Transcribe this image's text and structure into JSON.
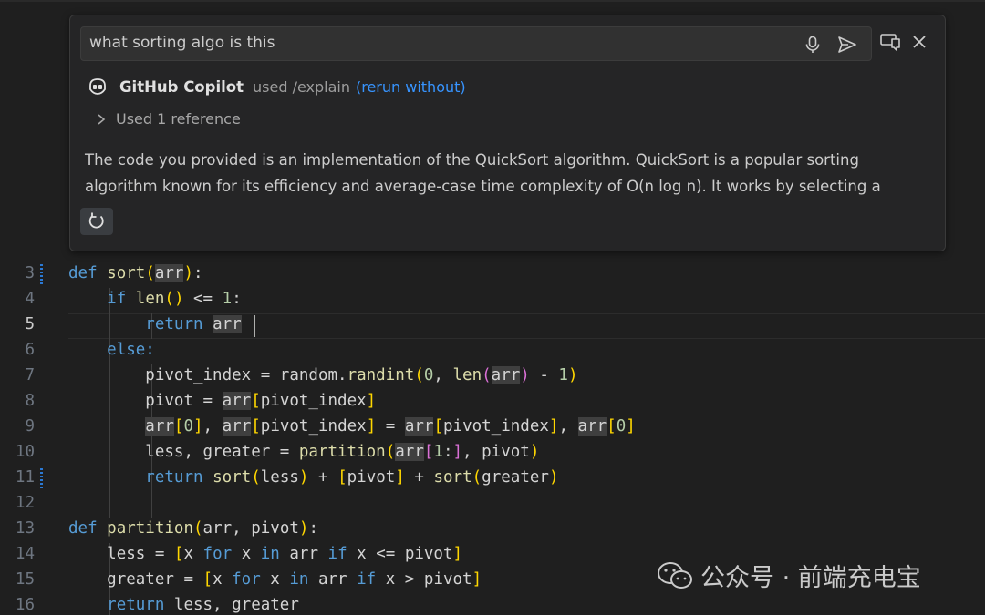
{
  "chat": {
    "query": "what sorting algo is this",
    "agent_name": "GitHub Copilot",
    "used_command": "used /explain",
    "rerun_link": "(rerun without)",
    "references": "Used 1 reference",
    "response_line1": "The code you provided is an implementation of the QuickSort algorithm. QuickSort is a popular sorting",
    "response_line2": "algorithm known for its efficiency and average-case time complexity of O(n log n). It works by selecting a"
  },
  "editor": {
    "line_numbers": [
      "3",
      "4",
      "5",
      "6",
      "7",
      "8",
      "9",
      "10",
      "11",
      "12",
      "13",
      "14",
      "15",
      "16"
    ],
    "active_line": "5"
  },
  "code": {
    "l3": {
      "def": "def",
      "sort": "sort",
      "p1": "(",
      "arr": "arr",
      "p2": ")",
      ":": ":"
    },
    "l4": {
      "if": "if",
      "len": "len",
      "rest": " <= ",
      "one": "1",
      ":": ":"
    },
    "l5": {
      "return": "return",
      "arr": "arr"
    },
    "l6": {
      "else": "else:"
    },
    "l7": {
      "pivot_index": "pivot_index = random.",
      "randint": "randint",
      "zero": "0",
      "len": "len",
      "minus": " - ",
      "one": "1"
    },
    "l8": {
      "pivot": "pivot = ",
      "arr": "arr",
      "idx": "pivot_index"
    },
    "l9": {
      "arr": "arr",
      "zero": "0",
      "idx": "pivot_index",
      "zero2": "0"
    },
    "l10": {
      "lg": "less, greater = ",
      "partition": "partition",
      "arr": "arr",
      "one": "1",
      "rest": "pivot"
    },
    "l11": {
      "return": "return",
      "sort": "sort",
      "less": "less",
      "plus": " + ",
      "pivot": "pivot",
      "greater": "greater"
    },
    "l13": {
      "def": "def",
      "partition": "partition",
      "args": "arr, pivot"
    },
    "l14": {
      "a": "less = ",
      "x": "x ",
      "for": "for",
      "in": "in",
      "if": "if",
      "b": " x <= pivot"
    },
    "l15": {
      "a": "greater = ",
      "x": "x ",
      "for": "for",
      "in": "in",
      "if": "if",
      "b": " x > pivot"
    },
    "l16": {
      "return": "return",
      "rest": " less, greater"
    }
  },
  "watermark": "公众号 · 前端充电宝"
}
